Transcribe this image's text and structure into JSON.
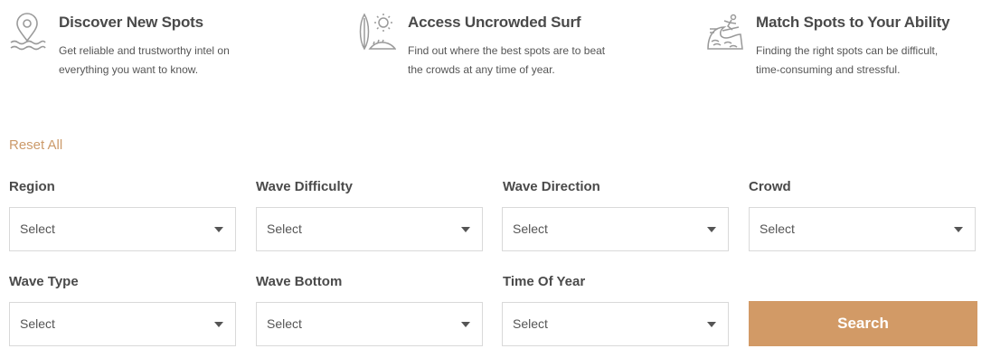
{
  "features": [
    {
      "title": "Discover New Spots",
      "desc": "Get reliable and trustworthy intel on everything you want to know.",
      "icon": "map-pin-waves-icon"
    },
    {
      "title": "Access Uncrowded Surf",
      "desc": "Find out where the best spots are to beat the crowds at any time of year.",
      "icon": "surfboard-sun-icon"
    },
    {
      "title": "Match Spots to Your Ability",
      "desc": "Finding the right spots can be difficult, time-consuming and stressful.",
      "icon": "surfer-wave-icon"
    }
  ],
  "filters": {
    "reset_label": "Reset All",
    "fields": [
      {
        "label": "Region",
        "value": "Select"
      },
      {
        "label": "Wave Difficulty",
        "value": "Select"
      },
      {
        "label": "Wave Direction",
        "value": "Select"
      },
      {
        "label": "Crowd",
        "value": "Select"
      },
      {
        "label": "Wave Type",
        "value": "Select"
      },
      {
        "label": "Wave Bottom",
        "value": "Select"
      },
      {
        "label": "Time Of Year",
        "value": "Select"
      }
    ],
    "search_label": "Search"
  },
  "colors": {
    "accent": "#d29a66",
    "reset_link": "#cc9a6a",
    "text_dark": "#4a4a4a",
    "icon_gray": "#9a9a9a"
  }
}
